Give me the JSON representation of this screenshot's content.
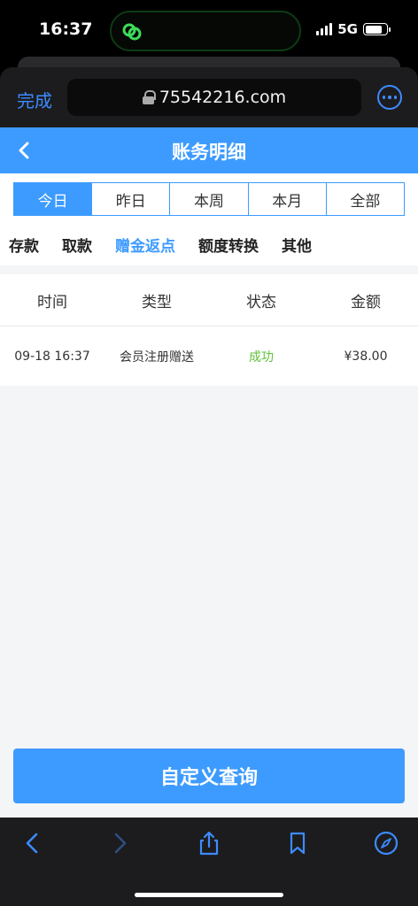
{
  "status_bar": {
    "time": "16:37",
    "network": "5G",
    "battery_level": 0.8
  },
  "browser": {
    "done_label": "完成",
    "url": "75542216.com",
    "icons": [
      "lock-icon",
      "more-icon",
      "back-arrow-icon",
      "forward-arrow-icon",
      "share-icon",
      "bookmarks-icon",
      "compass-icon"
    ]
  },
  "page": {
    "title": "账务明细",
    "period_tabs": [
      "今日",
      "昨日",
      "本周",
      "本月",
      "全部"
    ],
    "active_period": "今日",
    "type_tabs": [
      "存款",
      "取款",
      "赠金返点",
      "额度转换",
      "其他"
    ],
    "active_type": "赠金返点",
    "table": {
      "headers": [
        "时间",
        "类型",
        "状态",
        "金额"
      ],
      "rows": [
        {
          "time": "09-18 16:37",
          "type": "会员注册赠送",
          "status": "成功",
          "amount": "¥38.00"
        }
      ]
    },
    "query_button": "自定义查询"
  },
  "colors": {
    "accent": "#3d9bff",
    "success": "#62c23a",
    "browser_blue": "#3d8bff"
  }
}
